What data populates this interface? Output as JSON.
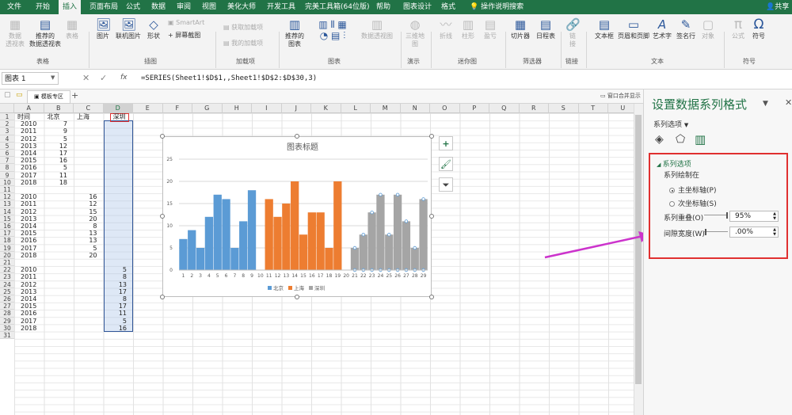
{
  "ribbon": {
    "tabs": [
      "文件",
      "开始",
      "插入",
      "页面布局",
      "公式",
      "数据",
      "审阅",
      "视图",
      "美化大师",
      "开发工具",
      "完美工具箱(64位版)",
      "帮助",
      "图表设计",
      "格式"
    ],
    "active_tab": "插入",
    "tell_me": "操作说明搜索",
    "share": "共享",
    "buttons": {
      "pivot": "数据\n透视表",
      "rec_pivot": "推荐的\n数据透视表",
      "table": "表格",
      "picture": "图片",
      "online_pic": "联机图片",
      "shapes": "形状",
      "smartart": "SmartArt",
      "screenshot": "屏幕截图",
      "get_addins": "获取加载项",
      "my_addins": "我的加载项",
      "rec_charts": "推荐的\n图表",
      "pivot_chart": "数据透视图",
      "map3d": "三维地\n图",
      "line": "折线",
      "column": "柱形",
      "winloss": "盈亏",
      "slicer": "切片器",
      "timeline": "日程表",
      "link": "链\n接",
      "textbox": "文本框",
      "header": "页眉和页脚",
      "wordart": "艺术字",
      "signature": "签名行",
      "object": "对象",
      "equation": "公式",
      "symbol": "符号"
    },
    "groups": [
      "表格",
      "插图",
      "加载项",
      "图表",
      "演示",
      "迷你图",
      "筛选器",
      "链接",
      "文本",
      "符号"
    ]
  },
  "formula_bar": {
    "name_box": "图表 1",
    "fx": "fx",
    "formula": "=SERIES(Sheet1!$D$1,,Sheet1!$D$2:$D$30,3)"
  },
  "workbook_strip": {
    "tab": "模板专区",
    "window_merge": "窗口合并显示"
  },
  "sheet": {
    "columns": [
      "A",
      "B",
      "C",
      "D",
      "E",
      "F",
      "G",
      "H",
      "I",
      "J",
      "K",
      "L",
      "M",
      "N",
      "O",
      "P",
      "Q",
      "R",
      "S",
      "T",
      "U"
    ],
    "headers": [
      "时间",
      "北京",
      "上海",
      "深圳"
    ],
    "rows": [
      [
        "2010",
        "7",
        "",
        ""
      ],
      [
        "2011",
        "9",
        "",
        ""
      ],
      [
        "2012",
        "5",
        "",
        ""
      ],
      [
        "2013",
        "12",
        "",
        ""
      ],
      [
        "2014",
        "17",
        "",
        ""
      ],
      [
        "2015",
        "16",
        "",
        ""
      ],
      [
        "2016",
        "5",
        "",
        ""
      ],
      [
        "2017",
        "11",
        "",
        ""
      ],
      [
        "2018",
        "18",
        "",
        ""
      ],
      [
        "",
        "",
        "",
        ""
      ],
      [
        "2010",
        "",
        "16",
        ""
      ],
      [
        "2011",
        "",
        "12",
        ""
      ],
      [
        "2012",
        "",
        "15",
        ""
      ],
      [
        "2013",
        "",
        "20",
        ""
      ],
      [
        "2014",
        "",
        "8",
        ""
      ],
      [
        "2015",
        "",
        "13",
        ""
      ],
      [
        "2016",
        "",
        "13",
        ""
      ],
      [
        "2017",
        "",
        "5",
        ""
      ],
      [
        "2018",
        "",
        "20",
        ""
      ],
      [
        "",
        "",
        "",
        ""
      ],
      [
        "2010",
        "",
        "",
        "5"
      ],
      [
        "2011",
        "",
        "",
        "8"
      ],
      [
        "2012",
        "",
        "",
        "13"
      ],
      [
        "2013",
        "",
        "",
        "17"
      ],
      [
        "2014",
        "",
        "",
        "8"
      ],
      [
        "2015",
        "",
        "",
        "17"
      ],
      [
        "2016",
        "",
        "",
        "11"
      ],
      [
        "2017",
        "",
        "",
        "5"
      ],
      [
        "2018",
        "",
        "",
        "16"
      ],
      [
        "",
        "",
        "",
        ""
      ]
    ]
  },
  "chart_data": {
    "type": "bar",
    "title": "图表标题",
    "categories": [
      "1",
      "2",
      "3",
      "4",
      "5",
      "6",
      "7",
      "8",
      "9",
      "10",
      "11",
      "12",
      "13",
      "14",
      "15",
      "16",
      "17",
      "18",
      "19",
      "20",
      "21",
      "22",
      "23",
      "24",
      "25",
      "26",
      "27",
      "28",
      "29"
    ],
    "ylim": [
      0,
      25
    ],
    "yticks": [
      0,
      5,
      10,
      15,
      20,
      25
    ],
    "grid": true,
    "legend": "bottom",
    "series": [
      {
        "name": "北京",
        "color": "#5b9bd5",
        "values": [
          7,
          9,
          5,
          12,
          17,
          16,
          5,
          11,
          18,
          null,
          null,
          null,
          null,
          null,
          null,
          null,
          null,
          null,
          null,
          null,
          null,
          null,
          null,
          null,
          null,
          null,
          null,
          null,
          null
        ]
      },
      {
        "name": "上海",
        "color": "#ed7d31",
        "values": [
          null,
          null,
          null,
          null,
          null,
          null,
          null,
          null,
          null,
          null,
          16,
          12,
          15,
          20,
          8,
          13,
          13,
          5,
          20,
          null,
          null,
          null,
          null,
          null,
          null,
          null,
          null,
          null,
          null
        ]
      },
      {
        "name": "深圳",
        "color": "#a5a5a5",
        "values": [
          null,
          null,
          null,
          null,
          null,
          null,
          null,
          null,
          null,
          null,
          null,
          null,
          null,
          null,
          null,
          null,
          null,
          null,
          null,
          null,
          5,
          8,
          13,
          17,
          8,
          17,
          11,
          5,
          16
        ]
      }
    ]
  },
  "pane": {
    "title": "设置数据系列格式",
    "series_options_menu": "系列选项",
    "section": "系列选项",
    "plot_on": "系列绘制在",
    "primary": "主坐标轴(P)",
    "secondary": "次坐标轴(S)",
    "overlap_label": "系列重叠(O)",
    "overlap_value": "95%",
    "gap_label": "间隙宽度(W)",
    "gap_value": ".00%",
    "highlight_color": "#e03030"
  },
  "annotation_color": "#cc33cc"
}
